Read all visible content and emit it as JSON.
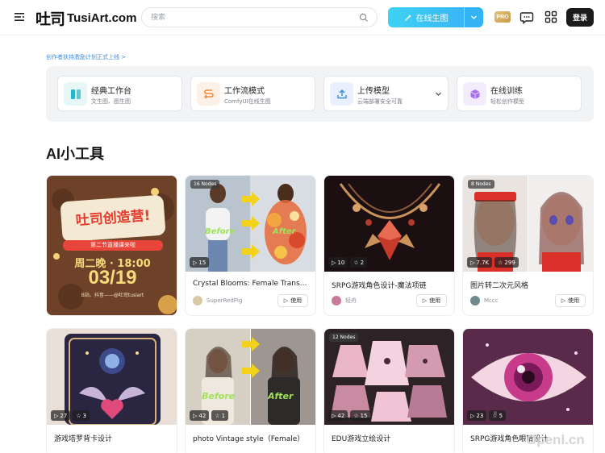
{
  "header": {
    "logo_mark": "吐司",
    "logo_text": "TusiArt.com",
    "search_placeholder": "搜索",
    "generate_label": "在线生图",
    "pro_label": "PRO",
    "login_label": "登录"
  },
  "creator_link": "创作者扶持激励计划正式上线 >",
  "quick_actions": [
    {
      "title": "经典工作台",
      "subtitle": "文生图、图生图",
      "icon": "layout-icon",
      "color": "#22b8c9"
    },
    {
      "title": "工作流模式",
      "subtitle": "ComfyUI在线生图",
      "icon": "workflow-icon",
      "color": "#f08a3a"
    },
    {
      "title": "上传模型",
      "subtitle": "云端部署安全可靠",
      "icon": "upload-icon",
      "color": "#3d8fe8"
    },
    {
      "title": "在线训练",
      "subtitle": "轻松创作模型",
      "icon": "cube-icon",
      "color": "#a86ff0"
    }
  ],
  "section_title": "AI小工具",
  "promo_card": {
    "headline": "吐司创造营!",
    "subline": "第二节直播课来啦",
    "schedule": "周二晚 · 18:00",
    "date": "03/19",
    "footer": "B站、抖音——@吐司tusiart"
  },
  "use_label": "使用",
  "cards_row1": [
    {
      "title": "Crystal Blooms: Female Transp...",
      "author": "SuperRedPig",
      "nodes": "16 Nodes",
      "runs": "15",
      "stars": "",
      "avatar_color": "#d8c9a6"
    },
    {
      "title": "SRPG游戏角色设计-魔法项链",
      "author": "轻舟",
      "nodes": "",
      "runs": "10",
      "stars": "2",
      "avatar_color": "#c77b9b"
    },
    {
      "title": "图片转二次元风格",
      "author": "Mccc",
      "nodes": "8 Nodes",
      "runs": "7.7K",
      "stars": "299",
      "avatar_color": "#6e8a8c"
    }
  ],
  "cards_row2": [
    {
      "title": "游戏塔罗背卡设计",
      "runs": "27",
      "stars": "3"
    },
    {
      "title": "photo Vintage style（Female）",
      "runs": "42",
      "stars": "1"
    },
    {
      "title": "EDU游戏立绘设计",
      "nodes": "12 Nodes",
      "runs": "42",
      "stars": "15"
    },
    {
      "title": "SRPG游戏角色眼睛设计",
      "runs": "23",
      "stars": "5"
    }
  ],
  "before_label": "Before",
  "after_label": "After",
  "watermark": "Openl.cn"
}
